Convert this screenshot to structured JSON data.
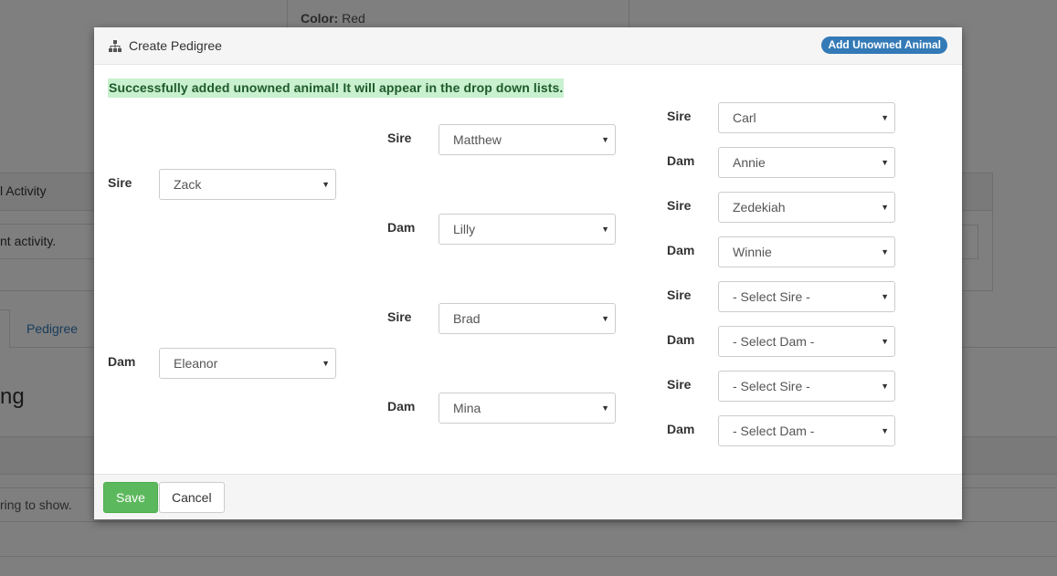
{
  "background": {
    "color_label": "Color:",
    "color_value": "Red",
    "activity_header": "l Activity",
    "activity_text": "nt activity.",
    "pedigree_tab": "Pedigree",
    "section_heading": "ng",
    "footer_text": "ring to show."
  },
  "modal": {
    "title": "Create Pedigree",
    "title_icon": "sitemap-icon",
    "add_button": "Add Unowned Animal",
    "success_message": "Successfully added unowned animal! It will appear in the drop down lists.",
    "gen1": [
      {
        "label": "Sire",
        "value": "Zack"
      },
      {
        "label": "Dam",
        "value": "Eleanor"
      }
    ],
    "gen2": [
      {
        "label": "Sire",
        "value": "Matthew"
      },
      {
        "label": "Dam",
        "value": "Lilly"
      },
      {
        "label": "Sire",
        "value": "Brad"
      },
      {
        "label": "Dam",
        "value": "Mina"
      }
    ],
    "gen3": [
      {
        "label": "Sire",
        "value": "Carl"
      },
      {
        "label": "Dam",
        "value": "Annie"
      },
      {
        "label": "Sire",
        "value": "Zedekiah"
      },
      {
        "label": "Dam",
        "value": "Winnie"
      },
      {
        "label": "Sire",
        "value": "- Select Sire -"
      },
      {
        "label": "Dam",
        "value": "- Select Dam -"
      },
      {
        "label": "Sire",
        "value": "- Select Sire -"
      },
      {
        "label": "Dam",
        "value": "- Select Dam -"
      }
    ],
    "save_button": "Save",
    "cancel_button": "Cancel"
  },
  "colors": {
    "primary": "#337ab7",
    "success_bg": "#c9f0cf",
    "save_green": "#5cb85c"
  }
}
